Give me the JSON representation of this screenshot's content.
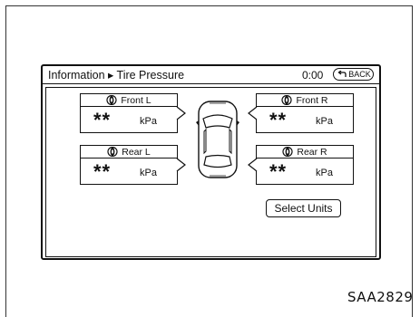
{
  "header": {
    "title": "Information ▸ Tire Pressure",
    "time": "0:00",
    "back_label": "BACK"
  },
  "tires": {
    "front_left": {
      "label": "Front L",
      "value": "**",
      "unit": "kPa"
    },
    "front_right": {
      "label": "Front R",
      "value": "**",
      "unit": "kPa"
    },
    "rear_left": {
      "label": "Rear L",
      "value": "**",
      "unit": "kPa"
    },
    "rear_right": {
      "label": "Rear R",
      "value": "**",
      "unit": "kPa"
    }
  },
  "buttons": {
    "select_units": "Select Units"
  },
  "figure_code": "SAA2829",
  "icons": {
    "tire": "tire-icon",
    "back": "back-arrow-icon",
    "car": "car-top-view-icon"
  }
}
